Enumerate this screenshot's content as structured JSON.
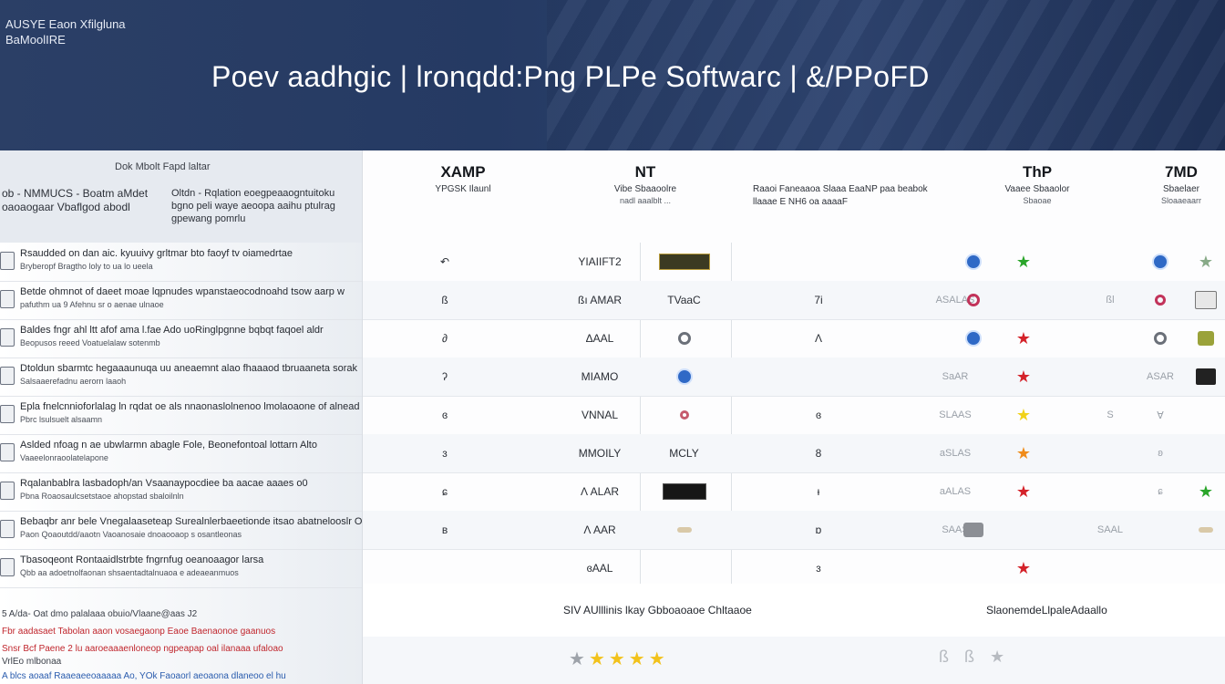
{
  "banner": {
    "logo_line1": "AUSYE Eaon Xfilgluna",
    "logo_line2": "BaMoolIRE",
    "title": "Poev aadhgic  | lronqdd:Png  PLPe Softwarc |  &/PPoFD"
  },
  "left": {
    "header_top": "Dok Mbolt Fapd laltar",
    "header_a": "ob - NMMUCS  -  Boatm aMdet  oaoaogaar  Vbaflgod abodl",
    "header_b": "Oltdn  -  Rqlation eoegpeaaogntuitoku bgno peli waye aeoopa aaihu ptulrag gpewang pomrlu",
    "rows": [
      {
        "t1": "Rsaudded on dan aic. kyuuivy grltmar bto faoyf tv oiamedrtae",
        "t2": "Bryberopf Bragtho loly to ua lo ueela"
      },
      {
        "t1": "Betde ohmnot of daeet moae lqpnudes wpanstaeocodnoahd tsow aarp w",
        "t2": "pafuthm ua 9 Afehnu sr o aenae ulnaoe"
      },
      {
        "t1": "Baldes fngr ahl ltt afof ama l.fae  Ado uoRinglpgnne bqbqt faqoel aldr",
        "t2": "Beopusos reeed Voatuelalaw sotenmb"
      },
      {
        "t1": "Dtoldun  sbarmtc hegaaaunuqa uu aneaemnt alao fhaaaod tbruaaneta sorak",
        "t2": "Salsaaerefadnu aerorn laaoh"
      },
      {
        "t1": "Epla fnelcnnioforlalag ln rqdat oe als nnaonaslolnenoo lmolaoaone of alnead",
        "t2": "Pbrc lsulsuelt alsaamn"
      },
      {
        "t1": "Aslded nfoag n ae ubwlarmn abagle Fole, Beonefontoal lottarn Alto",
        "t2": "Vaaeelonraoolatelapone"
      },
      {
        "t1": "Rqalanbablra lasbadoph/an Vsaanaypocdiee ba aacae aaaes o0",
        "t2": "Pbna Roaosaulcsetstaoe ahopstad sbaloilnln"
      },
      {
        "t1": "Bebaqbr anr bele Vnegalaaseteap Surealnlerbaeetionde itsao abatnelooslr Oatatipal",
        "t2": "Paon Qoaoutdd/aaotn Vaoanosaie dnoaooaop s osantleonas"
      },
      {
        "t1": "Tbasoqeont Rontaaidlstrbte fngrnfug oeanoaagor larsa",
        "t2": "Qbb aa adoetnolfaonan shsaentadtalnuaoa e adeaeanmuos"
      }
    ],
    "foot": [
      {
        "label": "5  A/da-   Oat dmo palalaaa obuio/Vlaane@aas  J2",
        "color": "normal"
      },
      {
        "label": "Fbr aadasaet  Tabolan aaon vosaegaonp  Eaoe  Baenaonoe gaanuos",
        "color": "red"
      },
      {
        "label": "Snsr  Bcf Paene 2 lu aaroeaaaenloneop ngpeapap oal  ilanaaa ufaloao",
        "color": "red"
      },
      {
        "label": "  VrlEo mlbonaa",
        "color": "normal"
      },
      {
        "label": "A blcs  aoaaf Raaeaeeoaaaaa Ao,  YOk Faoaorl aeoaona dlaneoo el hu",
        "color": "blue"
      }
    ]
  },
  "columns": [
    {
      "name": "XAMP",
      "sub": "YPGSK Ilaunl",
      "sub2": ""
    },
    {
      "name": "NT",
      "sub": "Vibe Sbaaoolre",
      "sub2": "nadl aaalblt ..."
    },
    {
      "name": "",
      "sub": "",
      "sub2": ""
    },
    {
      "name": "ThP",
      "sub": "Vaaee Sbaaolor",
      "sub2": "Sbaoae"
    },
    {
      "name": "7MD",
      "sub": "Sbaelaer",
      "sub2": "Sloaaeaarr"
    }
  ],
  "mid_note": "Raaoi Faneaaoa Slaaa EaaNP paa beabok llaaae   E NH6 oa aaaaF",
  "grid": [
    [
      "↶",
      "YIAIIFT2",
      "badge",
      "",
      "",
      "",
      "circle",
      "star-green",
      "",
      "circle",
      "star-lg"
    ],
    [
      "ß",
      "ßı AMAR",
      "TVaaC",
      "7i",
      "",
      "ASALAS",
      "ring-pink",
      "",
      "ßl",
      "pink",
      "pot"
    ],
    [
      "∂",
      "ΔAAL",
      "ring",
      "Λ",
      "",
      "",
      "circle",
      "star-red",
      "",
      "ring",
      "box"
    ],
    [
      "ʔ",
      "MIAMO",
      "circle",
      "",
      "",
      "SaAR",
      "",
      "star-red",
      "",
      "ASAR",
      "dark"
    ],
    [
      "ɞ",
      "VNNAL",
      "sm",
      "ɞ",
      "",
      "SLAAS",
      "",
      "star-yellow",
      "S",
      "Ɐ",
      ""
    ],
    [
      "ɜ",
      "MMOILY",
      "MCLY",
      "8",
      "",
      "aSLAS",
      "",
      "star-orange",
      "",
      "ʚ",
      ""
    ],
    [
      "ɕ",
      "Λ ALAR",
      "black",
      "ᵻ",
      "",
      "aALAS",
      "",
      "star-red",
      "",
      "ɕ",
      "star-green"
    ],
    [
      "ʙ",
      "Λ AAR",
      "pill",
      "ɒ",
      "",
      "SAAS",
      "grey-blob",
      "",
      "SAAL",
      "",
      "pill"
    ],
    [
      "",
      "ɞAAL",
      "",
      "ɜ",
      "",
      "",
      "",
      "star-red",
      "",
      "",
      ""
    ]
  ],
  "footer": {
    "row1_a": "SIV AUlllinis lkay    Gbboaoaoe Chltaaoe",
    "row1_b": "SlaonemdeLlpaleAdaallo",
    "rating_grey": "★",
    "rating_gold": "★★★★",
    "rating2": "ß ß  ★"
  }
}
